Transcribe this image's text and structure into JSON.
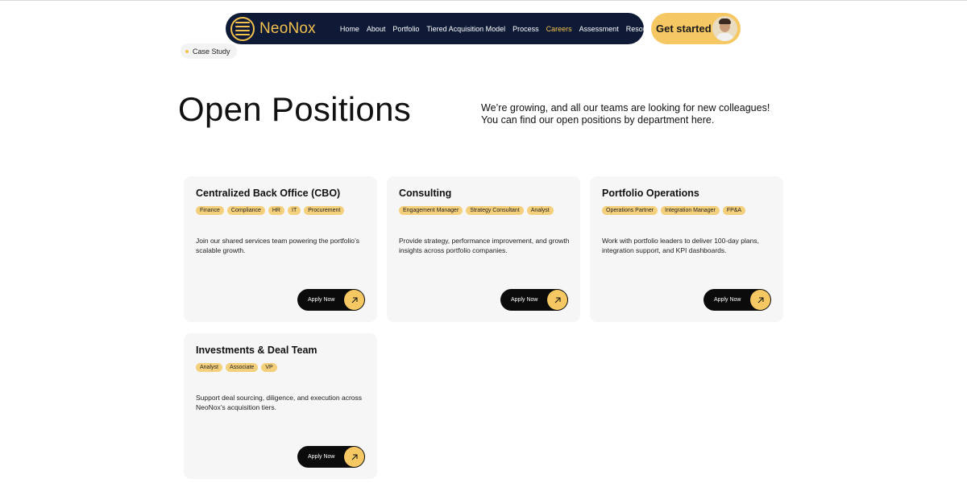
{
  "brand": {
    "name": "NeoNox"
  },
  "nav": {
    "links": [
      "Home",
      "About",
      "Portfolio",
      "Tiered Acquisition Model",
      "Process",
      "Careers",
      "Assessment",
      "Resources"
    ],
    "active": "Careers"
  },
  "cta": {
    "label": "Get started"
  },
  "chip": {
    "label": "Case Study"
  },
  "page": {
    "title": "Open Positions",
    "intro": "We’re growing, and all our teams are looking for new colleagues! You can find our open positions by department here."
  },
  "cards": [
    {
      "title": "Centralized Back Office (CBO)",
      "tags": [
        "Finance",
        "Compliance",
        "HR",
        "IT",
        "Procurement"
      ],
      "description": "Join our shared services team powering the portfolio’s scalable growth.",
      "button": "Apply Now"
    },
    {
      "title": "Consulting",
      "tags": [
        "Engagement Manager",
        "Strategy Consultant",
        "Analyst"
      ],
      "description": "Provide strategy, performance improvement, and growth insights across portfolio companies.",
      "button": "Apply Now"
    },
    {
      "title": "Portfolio Operations",
      "tags": [
        "Operations Partner",
        "Integration Manager",
        "FP&A"
      ],
      "description": "Work with portfolio leaders to deliver 100-day plans, integration support, and KPI dashboards.",
      "button": "Apply Now"
    },
    {
      "title": "Investments & Deal Team",
      "tags": [
        "Analyst",
        "Associate",
        "VP"
      ],
      "description": "Support deal sourcing, diligence, and execution across NeoNox’s acquisition tiers.",
      "button": "Apply Now"
    }
  ],
  "colors": {
    "navy": "#0e1a36",
    "accent": "#f5c863",
    "tag": "#f5d07c",
    "card": "#f6f6f6"
  }
}
